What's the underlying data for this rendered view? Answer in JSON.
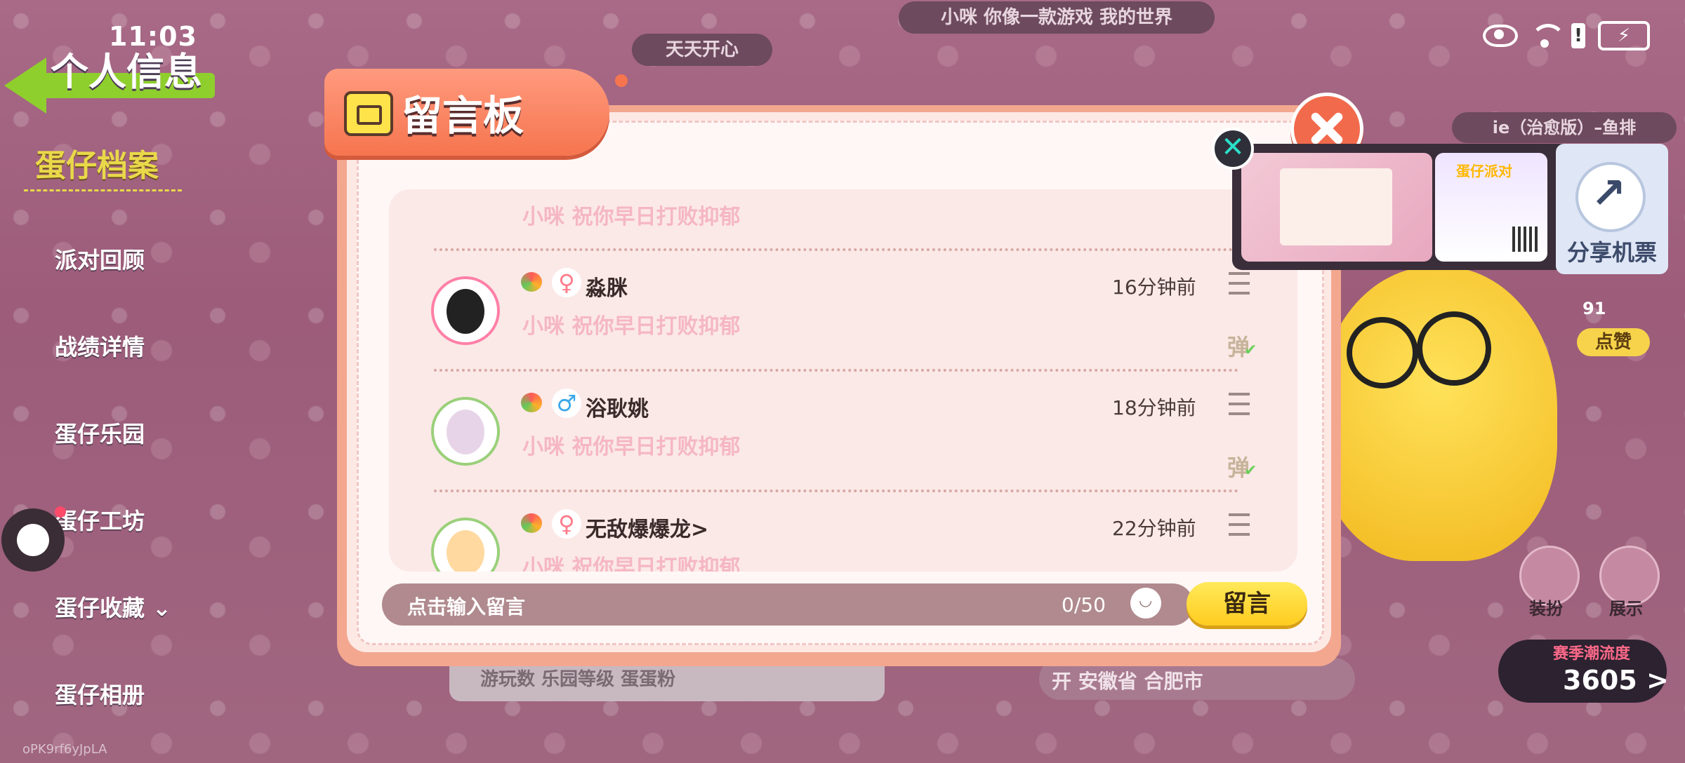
{
  "status_bar": {
    "time": "11:03",
    "alert_glyph": "!",
    "battery_glyph": "⚡"
  },
  "left_nav": {
    "back_title": "个人信息",
    "section_title": "蛋仔档案",
    "items": [
      "派对回顾",
      "战绩详情",
      "蛋仔乐园",
      "蛋仔工坊",
      "蛋仔收藏",
      "蛋仔相册"
    ],
    "collection_chevron": "⌄"
  },
  "watermark": "oPK9rf6yJpLA",
  "top_pills": {
    "subtitle": "小咪  你像一款游戏  我的世界",
    "tagline": "天天开心"
  },
  "modal": {
    "title": "留言板",
    "entries": [
      {
        "name": "",
        "message": "小咪  祝你早日打败抑郁",
        "time": "",
        "gender": "♀"
      },
      {
        "name": "淼脒",
        "message": "小咪  祝你早日打败抑郁",
        "time": "16分钟前",
        "gender": "♀",
        "danmu": "弹"
      },
      {
        "name": "浴耿姚",
        "message": "小咪  祝你早日打败抑郁",
        "time": "18分钟前",
        "gender": "♂",
        "danmu": "弹"
      },
      {
        "name": "无敌爆爆龙>",
        "message": "小咪  祝你早日打败抑郁",
        "time": "22分钟前",
        "gender": "♀"
      }
    ],
    "input_placeholder": "点击输入留言",
    "char_counter": "0/50",
    "send_label": "留言"
  },
  "share_popup": {
    "share_label": "分享机票",
    "thumb_title": "蛋仔派对",
    "close_glyph": "✕"
  },
  "right_panel": {
    "player_tag": "ie（治愈版）–鱼排",
    "likes": "91",
    "like_label": "点赞",
    "dress_label": "装扮",
    "show_label": "展示",
    "season_label": "赛季潮流度",
    "season_value": "3605 >"
  },
  "background_stats": {
    "left_strip": "游玩数   乐园等级   蛋蛋粉",
    "right_strip": "开    安徽省 合肥市"
  },
  "colors": {
    "accent": "#f6754f",
    "send": "#ffcc1f",
    "highlight_msg": "#f5b7c2"
  }
}
